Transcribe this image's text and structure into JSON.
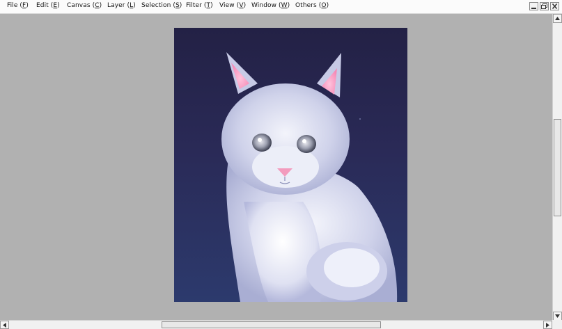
{
  "menu": {
    "file": {
      "pre": "File (",
      "key": "F",
      "post": ")"
    },
    "edit": {
      "pre": "Edit (",
      "key": "E",
      "post": ")"
    },
    "canvas": {
      "pre": "Canvas (",
      "key": "C",
      "post": ")"
    },
    "layer": {
      "pre": "Layer (",
      "key": "L",
      "post": ")"
    },
    "selection": {
      "pre": "Selection (",
      "key": "S",
      "post": ")"
    },
    "filter": {
      "pre": "Filter (",
      "key": "T",
      "post": ")"
    },
    "view": {
      "pre": "View (",
      "key": "V",
      "post": ")"
    },
    "window": {
      "pre": "Window (",
      "key": "W",
      "post": ")"
    },
    "others": {
      "pre": "Others (",
      "key": "O",
      "post": ")"
    }
  },
  "window_controls": [
    "minimize-icon",
    "restore-icon",
    "close-icon"
  ],
  "scroll_icons": [
    "arrow-up-icon",
    "arrow-down-icon",
    "arrow-left-icon",
    "arrow-right-icon"
  ],
  "colors": {
    "workspace": "#b1b1b1",
    "canvas_bg_top": "#26244a",
    "canvas_bg_bottom": "#2b3769",
    "cat_fur": "#d9dcef",
    "ear_pink": "#f7a6c8",
    "nose_pink": "#f39bbd"
  }
}
